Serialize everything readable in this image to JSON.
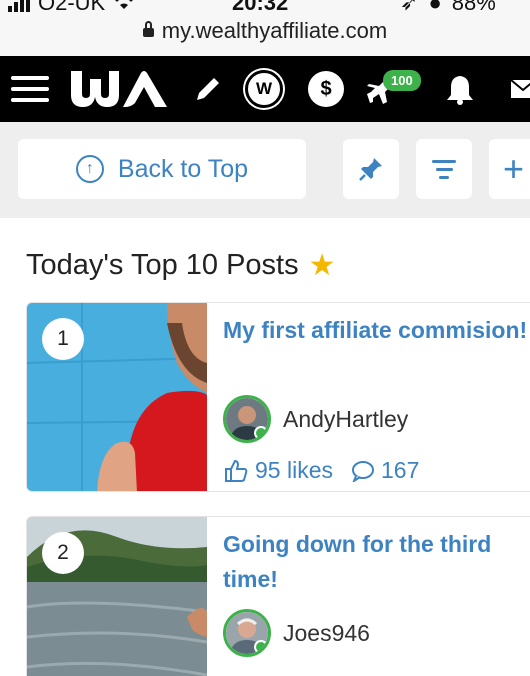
{
  "status": {
    "carrier": "O2-UK",
    "time": "20:32",
    "battery": "88%"
  },
  "browser": {
    "url": "my.wealthyaffiliate.com"
  },
  "nav": {
    "logo_text": "WA",
    "notification_count": "100"
  },
  "toolbar": {
    "back_to_top_label": "Back to Top",
    "plus_label": "+"
  },
  "section": {
    "title": "Today's Top 10 Posts"
  },
  "posts": [
    {
      "rank": "1",
      "title": "My first affiliate commision!",
      "author": "AndyHartley",
      "likes": "95 likes",
      "comments": "167"
    },
    {
      "rank": "2",
      "title": "Going down for the third time!",
      "author": "Joes946",
      "likes": "",
      "comments": ""
    }
  ],
  "colors": {
    "accent": "#3d83c2",
    "green": "#3eb24a",
    "star": "#f5b800"
  }
}
